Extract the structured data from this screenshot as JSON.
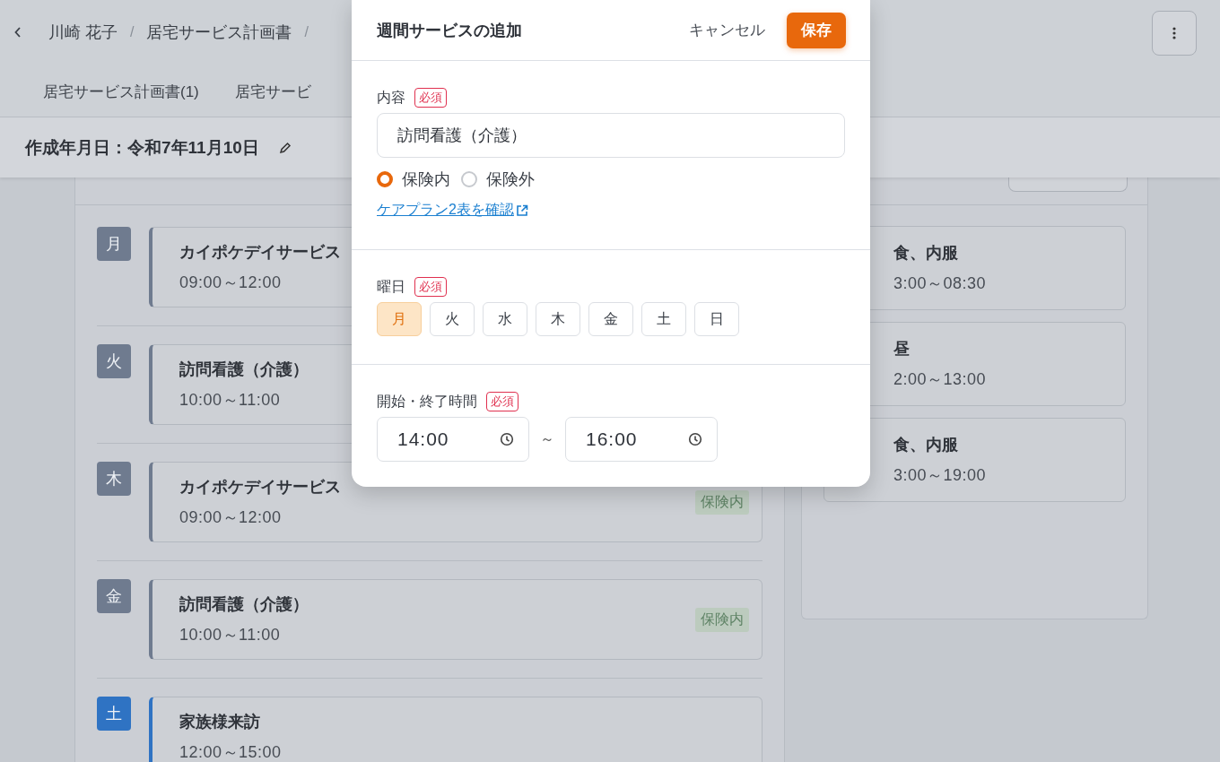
{
  "header": {
    "breadcrumbs": [
      "川崎 花子",
      "居宅サービス計画書"
    ],
    "separator": "/"
  },
  "tabs": [
    {
      "label": "居宅サービス計画書(1)",
      "selected": false
    },
    {
      "label": "居宅サービ",
      "selected": false
    }
  ],
  "date": {
    "label": "作成年月日：令和7年11月10日"
  },
  "weekly": {
    "items": [
      {
        "day": "月",
        "color": "#6f7b8f",
        "title": "カイポケデイサービス",
        "time": "09:00～12:00"
      },
      {
        "day": "火",
        "color": "#6f7b8f",
        "title": "訪問看護（介護）",
        "time": "10:00～11:00"
      },
      {
        "day": "木",
        "color": "#6f7b8f",
        "title": "カイポケデイサービス",
        "time": "09:00～12:00",
        "badge": "保険内"
      },
      {
        "day": "金",
        "color": "#6f7b8f",
        "title": "訪問看護（介護）",
        "time": "10:00～11:00",
        "badge": "保険内"
      },
      {
        "day": "土",
        "color": "#2f73c3",
        "title": "家族様来訪",
        "time": "12:00～15:00"
      }
    ]
  },
  "activities": {
    "items": [
      {
        "title": "食、内服",
        "time": "3:00～08:30"
      },
      {
        "title": "昼",
        "time": "2:00～13:00"
      },
      {
        "title": "食、内服",
        "time": "3:00～19:00"
      }
    ]
  },
  "dialog": {
    "title": "週間サービスの追加",
    "cancel": "キャンセル",
    "save": "保存",
    "content": {
      "label": "内容",
      "required": "必須",
      "value": "訪問看護（介護）",
      "options": [
        {
          "label": "保険内",
          "selected": true
        },
        {
          "label": "保険外",
          "selected": false
        }
      ],
      "link": "ケアプラン2表を確認"
    },
    "days": {
      "label": "曜日",
      "required": "必須",
      "items": [
        {
          "label": "月",
          "selected": true
        },
        {
          "label": "火",
          "selected": false
        },
        {
          "label": "水",
          "selected": false
        },
        {
          "label": "木",
          "selected": false
        },
        {
          "label": "金",
          "selected": false
        },
        {
          "label": "土",
          "selected": false
        },
        {
          "label": "日",
          "selected": false
        }
      ]
    },
    "time": {
      "label": "開始・終了時間",
      "required": "必須",
      "start": "14:00",
      "separator": "～",
      "end": "16:00"
    }
  }
}
